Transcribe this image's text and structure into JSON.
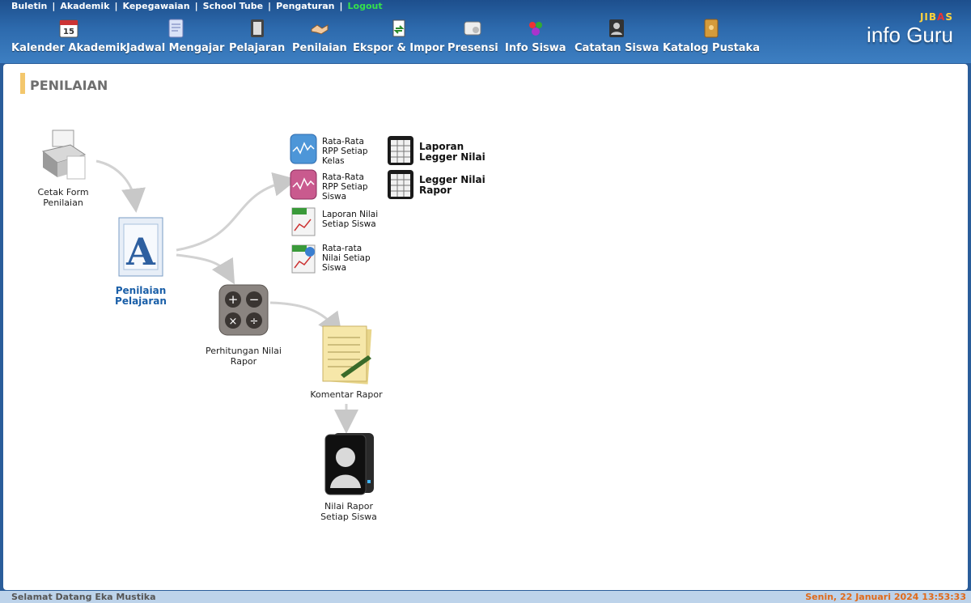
{
  "top_nav": {
    "buletin": "Buletin",
    "akademik": "Akademik",
    "kepegawaian": "Kepegawaian",
    "school_tube": "School Tube",
    "pengaturan": "Pengaturan",
    "logout": "Logout",
    "separator": "|"
  },
  "main_nav": {
    "kalender": "Kalender Akademik",
    "jadwal": "Jadwal Mengajar",
    "pelajaran": "Pelajaran",
    "penilaian": "Penilaian",
    "ekspor": "Ekspor & Impor",
    "presensi": "Presensi",
    "info_siswa": "Info Siswa",
    "catatan": "Catatan Siswa",
    "katalog": "Katalog Pustaka"
  },
  "brand": {
    "jibas_a": "JIB",
    "jibas_b": "A",
    "jibas_c": "S",
    "info_guru": "info Guru"
  },
  "page": {
    "title": "PENILAIAN"
  },
  "workflow": {
    "cetak_form": "Cetak Form Penilaian",
    "penilaian_pelajaran": "Penilaian Pelajaran",
    "perhitungan": "Perhitungan Nilai Rapor",
    "komentar": "Komentar Rapor",
    "nilai_rapor": "Nilai Rapor Setiap Siswa",
    "rata_kelas": "Rata-Rata RPP Setiap Kelas",
    "rata_siswa": "Rata-Rata RPP Setiap Siswa",
    "laporan_nilai": "Laporan Nilai Setiap Siswa",
    "rata_nilai": "Rata-rata Nilai Setiap Siswa",
    "legger_nilai": "Laporan Legger Nilai",
    "legger_rapor": "Legger Nilai Rapor"
  },
  "calendar_day": "15",
  "footer": {
    "welcome": "Selamat Datang Eka Mustika",
    "datetime": "Senin, 22 Januari 2024 13:53:33"
  },
  "colors": {
    "header": "#2d6aad",
    "accent_title": "#f3c76c",
    "logout": "#35e04b",
    "link_blue": "#1a5fa8",
    "datetime": "#e06a1a"
  }
}
